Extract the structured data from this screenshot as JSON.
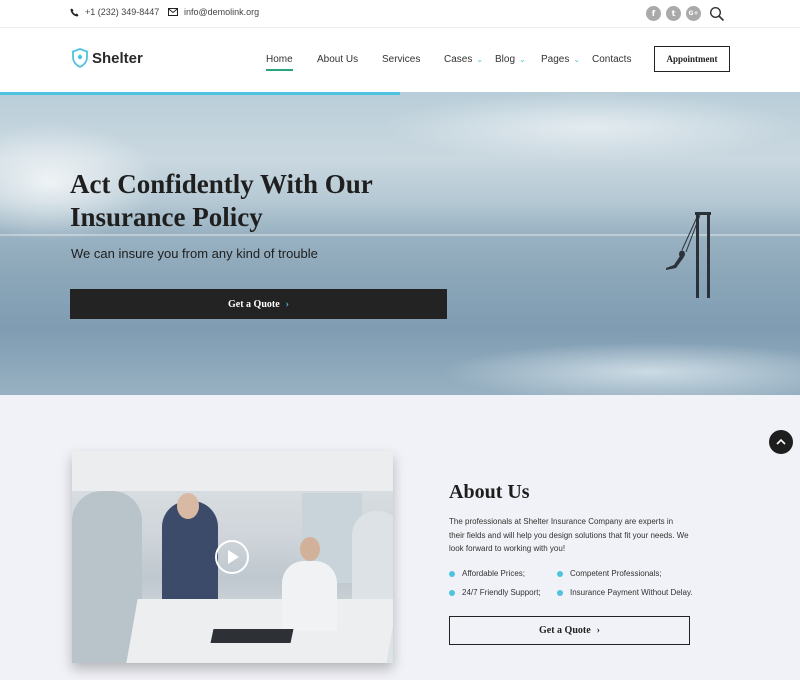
{
  "topbar": {
    "phone": "+1 (232) 349-8447",
    "email": "info@demolink.org",
    "social": [
      {
        "icon": "facebook-icon",
        "glyph": "f"
      },
      {
        "icon": "twitter-icon",
        "glyph": "t"
      },
      {
        "icon": "google-plus-icon",
        "glyph": "G+"
      }
    ]
  },
  "header": {
    "logo_text": "Shelter",
    "nav": [
      {
        "label": "Home",
        "active": true
      },
      {
        "label": "About Us"
      },
      {
        "label": "Services"
      },
      {
        "label": "Cases",
        "dropdown": true
      },
      {
        "label": "Blog",
        "dropdown": true
      },
      {
        "label": "Pages",
        "dropdown": true
      },
      {
        "label": "Contacts"
      }
    ],
    "appointment_label": "Appointment"
  },
  "hero": {
    "title": "Act Confidently With Our Insurance Policy",
    "subtitle": "We can insure you from any kind of trouble",
    "button_label": "Get a Quote",
    "slider_progress": 0.5
  },
  "about": {
    "title": "About Us",
    "text": "The professionals at Shelter Insurance Company are experts in their fields and will help you design solutions that fit your needs. We look forward to working with you!",
    "features": [
      "Affordable Prices;",
      "Competent Professionals;",
      "24/7 Friendly Support;",
      "Insurance Payment Without Delay."
    ],
    "button_label": "Get a Quote"
  },
  "colors": {
    "accent": "#4fc3de",
    "active_underline": "#2aa37f",
    "dark_button": "#232323"
  }
}
